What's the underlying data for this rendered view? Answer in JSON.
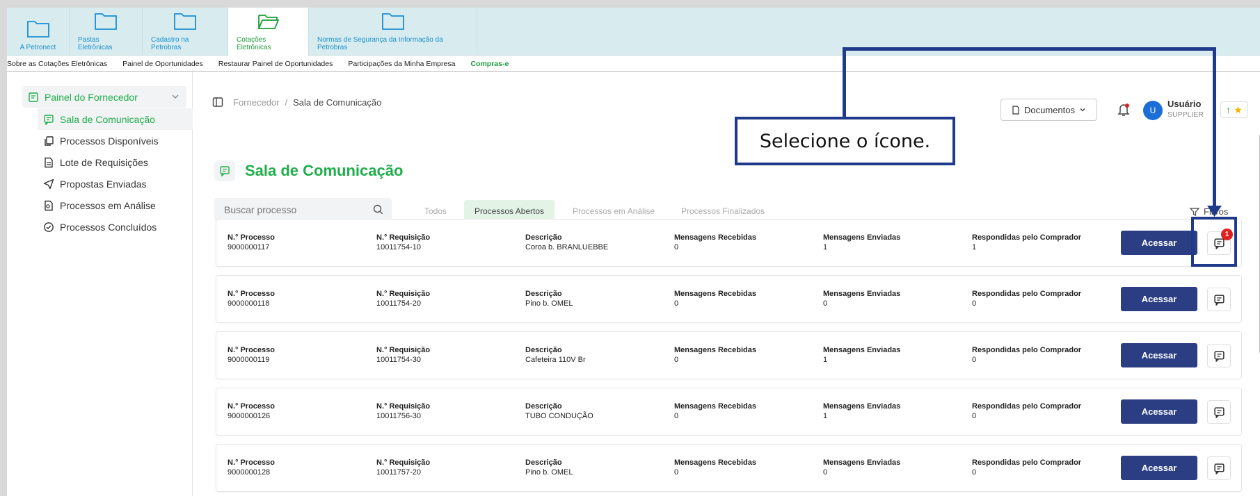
{
  "portal_tabs": [
    {
      "label": "A Petronect",
      "active": false
    },
    {
      "label": "Pastas Eletrônicas",
      "active": false
    },
    {
      "label": "Cadastro na Petrobras",
      "active": false
    },
    {
      "label": "Cotações Eletrônicas",
      "active": true
    },
    {
      "label": "Normas de Segurança da Informação da Petrobras",
      "active": false
    }
  ],
  "sublinks": [
    "Sobre as Cotações Eletrônicas",
    "Painel de Oportunidades",
    "Restaurar Painel de Oportunidades",
    "Participações da Minha Empresa",
    "Compras-e"
  ],
  "sidebar": {
    "header": "Painel do Fornecedor",
    "items": [
      {
        "label": "Sala de Comunicação",
        "active": true
      },
      {
        "label": "Processos Disponíveis"
      },
      {
        "label": "Lote de Requisições"
      },
      {
        "label": "Propostas Enviadas"
      },
      {
        "label": "Processos em Análise"
      },
      {
        "label": "Processos Concluídos"
      }
    ]
  },
  "breadcrumb": {
    "parent": "Fornecedor",
    "separator": "/",
    "current": "Sala de Comunicação"
  },
  "header": {
    "documents_label": "Documentos",
    "user_initial": "U",
    "user_name": "Usuário",
    "user_role": "SUPPLIER"
  },
  "page_title": "Sala de Comunicação",
  "search": {
    "placeholder": "Buscar processo"
  },
  "filter_tabs": [
    "Todos",
    "Processos Abertos",
    "Processos em Análise",
    "Processos Finalizados"
  ],
  "active_filter": "Processos Abertos",
  "filters_label": "Filtros",
  "columns": {
    "processo": "N.° Processo",
    "requisicao": "N.° Requisição",
    "descricao": "Descrição",
    "recebidas": "Mensagens Recebidas",
    "enviadas": "Mensagens Enviadas",
    "respondidas": "Respondidas pelo Comprador"
  },
  "access_label": "Acessar",
  "rows": [
    {
      "processo": "9000000117",
      "requisicao": "10011754-10",
      "descricao": "Coroa b. BRANLUEBBE",
      "recebidas": "0",
      "enviadas": "1",
      "respondidas": "1",
      "badge": "1"
    },
    {
      "processo": "9000000118",
      "requisicao": "10011754-20",
      "descricao": "Pino b. OMEL",
      "recebidas": "0",
      "enviadas": "0",
      "respondidas": "0"
    },
    {
      "processo": "9000000119",
      "requisicao": "10011754-30",
      "descricao": "Cafeteira 110V Br",
      "recebidas": "0",
      "enviadas": "1",
      "respondidas": "0"
    },
    {
      "processo": "9000000126",
      "requisicao": "10011756-30",
      "descricao": "TUBO CONDUÇÃO",
      "recebidas": "0",
      "enviadas": "1",
      "respondidas": "0"
    },
    {
      "processo": "9000000128",
      "requisicao": "10011757-20",
      "descricao": "Pino b. OMEL",
      "recebidas": "0",
      "enviadas": "0",
      "respondidas": "0"
    }
  ],
  "annotation": {
    "text": "Selecione o ícone."
  },
  "colors": {
    "green": "#1fae4b",
    "navy": "#2c3e83",
    "annotation": "#1f3a8a",
    "badge": "#e02020"
  }
}
